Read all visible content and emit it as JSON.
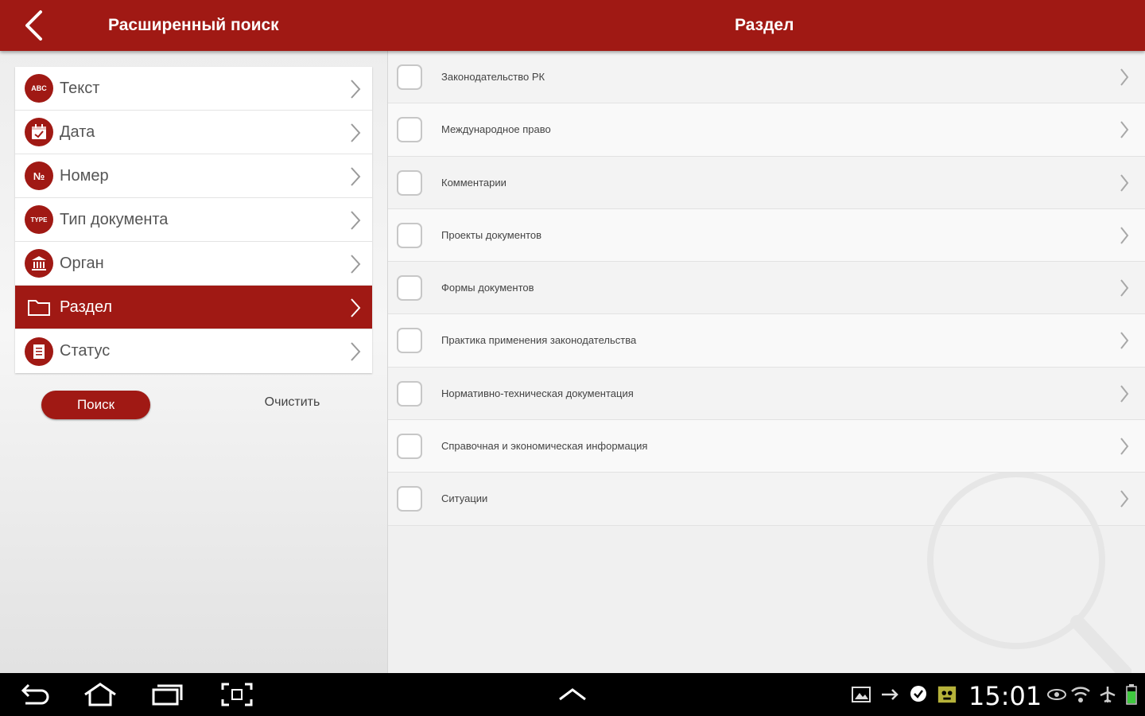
{
  "header": {
    "left_title": "Расширенный поиск",
    "right_title": "Раздел"
  },
  "menu": {
    "items": [
      {
        "label": "Текст",
        "icon": "abc-icon",
        "badge": "ABC"
      },
      {
        "label": "Дата",
        "icon": "calendar-icon"
      },
      {
        "label": "Номер",
        "icon": "number-icon",
        "badge": "№"
      },
      {
        "label": "Тип документа",
        "icon": "type-icon",
        "badge": "TYPE"
      },
      {
        "label": "Орган",
        "icon": "building-icon"
      },
      {
        "label": "Раздел",
        "icon": "folder-icon",
        "active": true
      },
      {
        "label": "Статус",
        "icon": "document-icon"
      }
    ]
  },
  "actions": {
    "search_label": "Поиск",
    "clear_label": "Очистить"
  },
  "sections": {
    "items": [
      "Законодательство РК",
      "Международное право",
      "Комментарии",
      "Проекты документов",
      "Формы документов",
      "Практика применения законодательства",
      "Нормативно-техническая документация",
      "Справочная и экономическая информация",
      "Ситуации"
    ]
  },
  "system": {
    "clock": "15:01"
  },
  "colors": {
    "brand": "#a01914",
    "battery": "#3fc83f"
  }
}
